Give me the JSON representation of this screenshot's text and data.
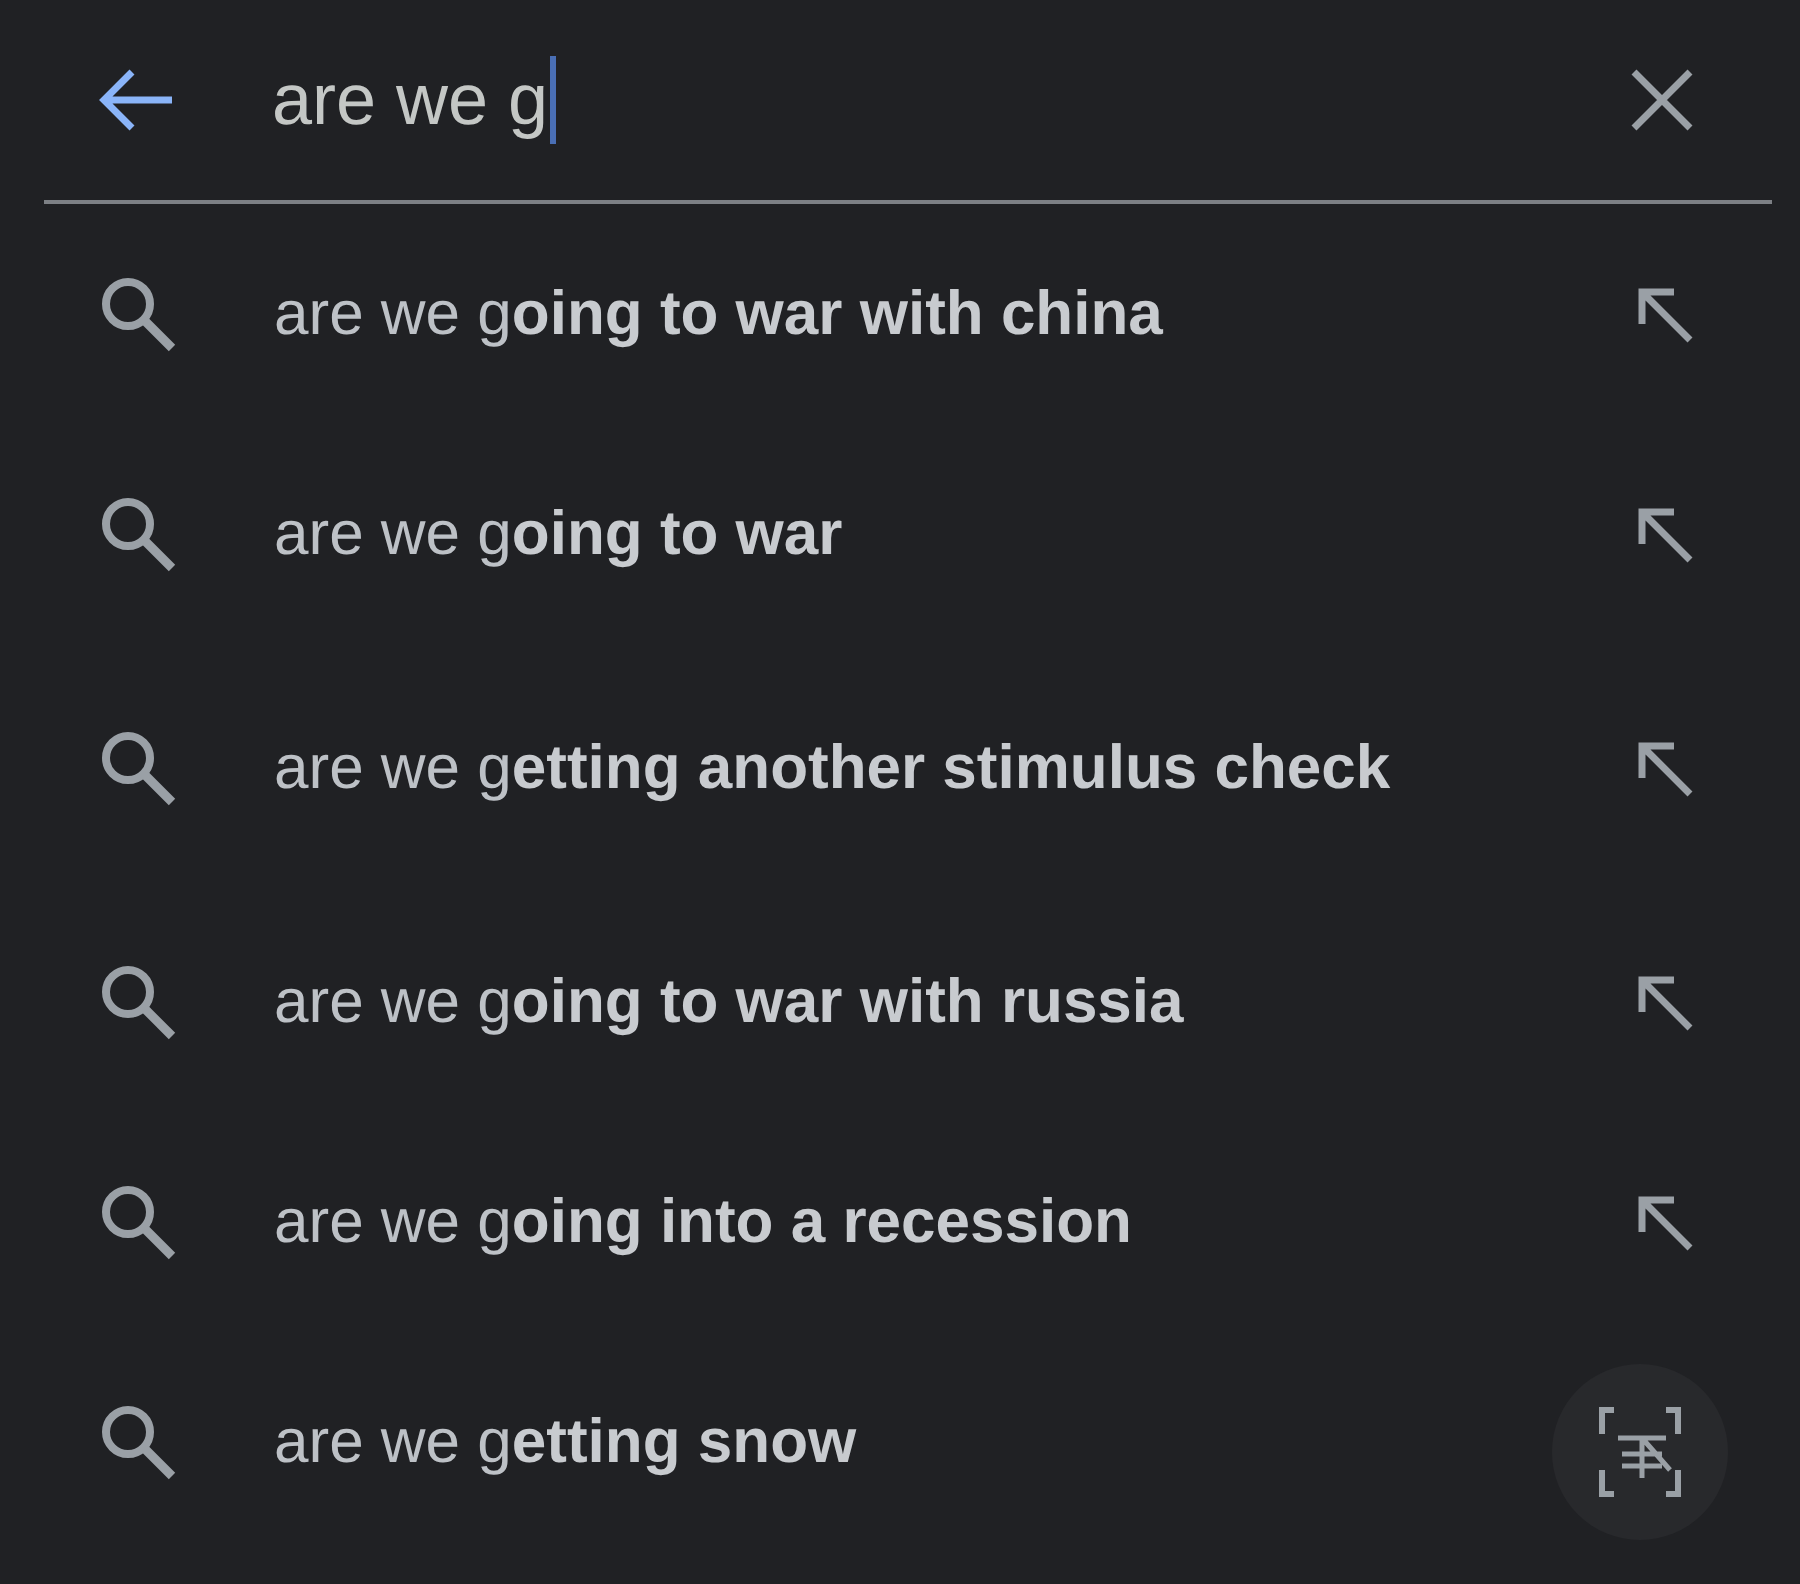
{
  "search": {
    "value": "are we g"
  },
  "suggestions": [
    {
      "text": "are we g**oing to war with china**",
      "kind": "with-arrow"
    },
    {
      "text": "are we g**oing to war**",
      "kind": "with-arrow"
    },
    {
      "text": "are we g**etting another stimulus check**",
      "kind": "with-arrow"
    },
    {
      "text": "are we g**oing to war with russia**",
      "kind": "with-arrow"
    },
    {
      "text": "are we g**oing into a recession**",
      "kind": "with-arrow"
    },
    {
      "text": "are we g**etting snow**",
      "kind": "plain"
    }
  ]
}
